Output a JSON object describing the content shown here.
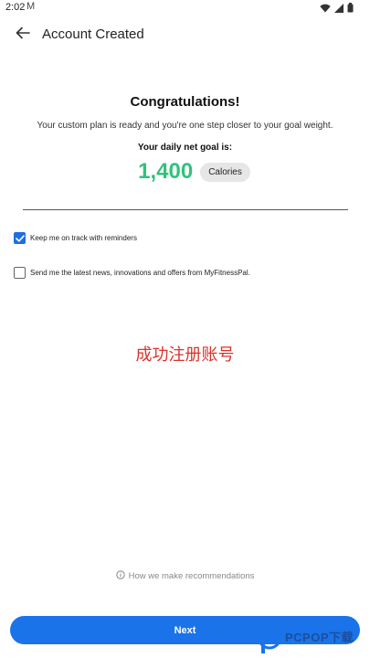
{
  "status_bar": {
    "time": "2:02",
    "mail_glyph": "M",
    "icons": [
      "wifi-icon",
      "signal-icon",
      "battery-icon"
    ]
  },
  "app_bar": {
    "back_icon": "arrow-left-icon",
    "title": "Account Created"
  },
  "content": {
    "headline": "Congratulations!",
    "plan_text": "Your custom plan is ready and you're one step closer to your goal weight.",
    "goal_label": "Your daily net goal is:",
    "goal_value": "1,400",
    "goal_unit": "Calories"
  },
  "checkboxes": [
    {
      "label": "Keep me on track with reminders",
      "checked": true
    },
    {
      "label": "Send me the latest news, innovations and offers from MyFitnessPal.",
      "checked": false
    }
  ],
  "watermark_text": "成功注册账号",
  "footer": {
    "recommend_icon": "info-circle-icon",
    "recommend_text": "How we make recommendations",
    "next_label": "Next"
  },
  "site_logo_text": "PCPOP下载",
  "colors": {
    "accent": "#1a73e8",
    "checkbox_on": "#1f6fe0",
    "goal_green": "#31c27c",
    "watermark_red": "#d9332d",
    "logo_blue": "#1a4fa0"
  }
}
